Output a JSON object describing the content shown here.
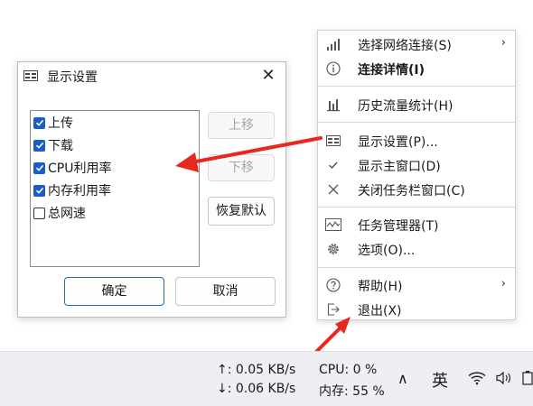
{
  "dialog": {
    "title": "显示设置",
    "close_glyph": "✕",
    "items": [
      {
        "label": "上传",
        "checked": true
      },
      {
        "label": "下载",
        "checked": true
      },
      {
        "label": "CPU利用率",
        "checked": true
      },
      {
        "label": "内存利用率",
        "checked": true
      },
      {
        "label": "总网速",
        "checked": false
      }
    ],
    "move_up_label": "上移",
    "move_down_label": "下移",
    "restore_default_label": "恢复默认",
    "ok_label": "确定",
    "cancel_label": "取消"
  },
  "context_menu": {
    "items": [
      {
        "icon": "signal-bars-icon",
        "label": "选择网络连接(S)",
        "submenu": true,
        "bold": false
      },
      {
        "icon": "info-icon",
        "label": "连接详情(I)",
        "submenu": false,
        "bold": true
      },
      {
        "icon": "bar-chart-icon",
        "label": "历史流量统计(H)",
        "submenu": false,
        "bold": false
      },
      {
        "icon": "display-settings-icon",
        "label": "显示设置(P)...",
        "submenu": false,
        "bold": false
      },
      {
        "icon": "checkmark-icon",
        "label": "显示主窗口(D)",
        "submenu": false,
        "bold": false
      },
      {
        "icon": "close-icon",
        "label": "关闭任务栏窗口(C)",
        "submenu": false,
        "bold": false
      },
      {
        "icon": "task-manager-icon",
        "label": "任务管理器(T)",
        "submenu": false,
        "bold": false
      },
      {
        "icon": "gear-icon",
        "label": "选项(O)...",
        "submenu": false,
        "bold": false
      },
      {
        "icon": "help-icon",
        "label": "帮助(H)",
        "submenu": true,
        "bold": false
      },
      {
        "icon": "exit-icon",
        "label": "退出(X)",
        "submenu": false,
        "bold": false
      }
    ],
    "submenu_glyph": "›"
  },
  "taskbar": {
    "upload": "↑: 0.05 KB/s",
    "download": "↓: 0.06 KB/s",
    "cpu": "CPU: 0 %",
    "memory": "内存: 55 %",
    "ime": "英",
    "chevron_glyph": "∧"
  },
  "colors": {
    "checkbox_accent": "#1a5dc9",
    "arrow_red": "#e8281f",
    "primary_border": "#1f6fc0"
  }
}
